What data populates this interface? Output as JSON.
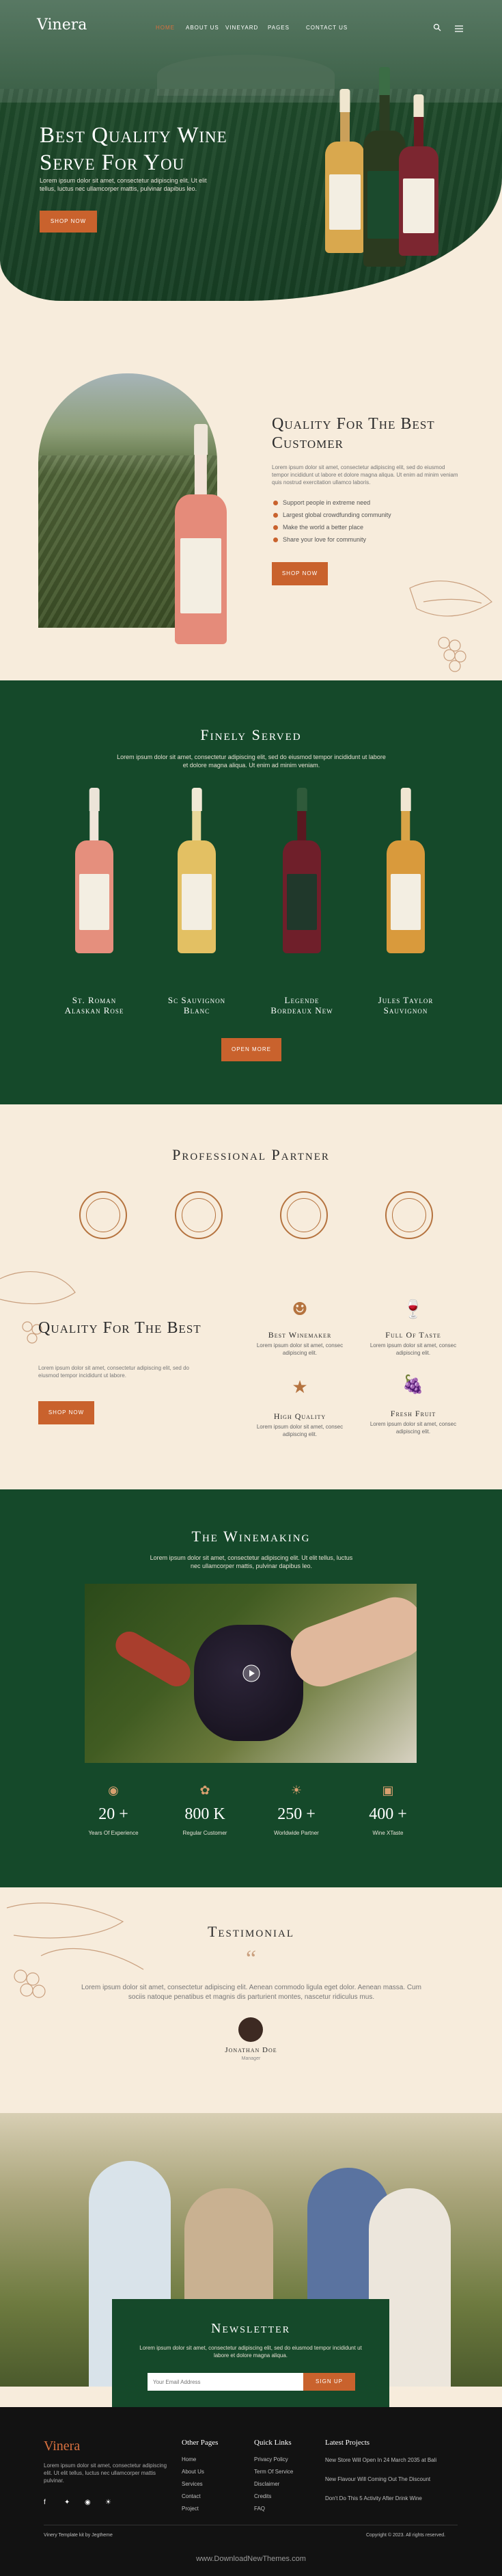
{
  "brand": "Vinera",
  "nav": {
    "items": [
      "HOME",
      "ABOUT US",
      "VINEYARD",
      "PAGES",
      "CONTACT US"
    ],
    "active": "HOME",
    "search_icon": "search-icon",
    "menu_icon": "menu-icon"
  },
  "hero": {
    "title": "Best Quality Wine Serve For You",
    "text": "Lorem ipsum dolor sit amet, consectetur adipiscing elit. Ut elit tellus, luctus nec ullamcorper mattis, pulvinar dapibus leo.",
    "button": "SHOP NOW"
  },
  "quality": {
    "title": "Quality For The Best Customer",
    "text": "Lorem ipsum dolor sit amet, consectetur adipiscing elit, sed do eiusmod tempor incididunt ut labore et dolore magna aliqua. Ut enim ad minim veniam quis nostrud exercitation ullamco laboris.",
    "list": [
      "Support people in extreme need",
      "Largest global crowdfunding community",
      "Make the world a better place",
      "Share your love for community"
    ],
    "button": "SHOP NOW"
  },
  "finely": {
    "title": "Finely Served",
    "text": "Lorem ipsum dolor sit amet, consectetur adipiscing elit, sed do eiusmod tempor incididunt ut labore et dolore magna aliqua. Ut enim ad minim veniam.",
    "wines": [
      {
        "name1": "St. Roman",
        "name2": "Alaskan Rose"
      },
      {
        "name1": "Sc Sauvignon",
        "name2": "Blanc"
      },
      {
        "name1": "Legende",
        "name2": "Bordeaux New"
      },
      {
        "name1": "Jules Taylor",
        "name2": "Sauvignon"
      }
    ],
    "button": "OPEN MORE"
  },
  "partner": {
    "title": "Professional Partner",
    "badges": [
      "",
      "",
      "",
      ""
    ]
  },
  "quality2": {
    "title": "Quality For The Best",
    "text": "Lorem ipsum dolor sit amet, consectetur adipiscing elit, sed do eiusmod tempor incididunt ut labore.",
    "button": "SHOP NOW",
    "features": [
      {
        "title": "Best Winemaker",
        "text": "Lorem ipsum dolor sit amet, consec adipiscing elit."
      },
      {
        "title": "Full Of Taste",
        "text": "Lorem ipsum dolor sit amet, consec adipiscing elit."
      },
      {
        "title": "High Quality",
        "text": "Lorem ipsum dolor sit amet, consec adipiscing elit."
      },
      {
        "title": "Fresh Fruit",
        "text": "Lorem ipsum dolor sit amet, consec adipiscing elit."
      }
    ]
  },
  "winemaking": {
    "title": "The Winemaking",
    "text": "Lorem ipsum dolor sit amet, consectetur adipiscing elit. Ut elit tellus, luctus nec ullamcorper mattis, pulvinar dapibus leo.",
    "stats": [
      {
        "num": "20 +",
        "label": "Years Of Experience"
      },
      {
        "num": "800 K",
        "label": "Regular Customer"
      },
      {
        "num": "250 +",
        "label": "Worldwide Partner"
      },
      {
        "num": "400 +",
        "label": "Wine XTaste"
      }
    ]
  },
  "testimonial": {
    "title": "Testimonial",
    "quote": "Lorem ipsum dolor sit amet, consectetur adipiscing elit. Aenean commodo ligula eget dolor. Aenean massa. Cum sociis natoque penatibus et magnis dis parturient montes, nascetur ridiculus mus.",
    "name": "Jonathan Doe",
    "role": "Manager"
  },
  "newsletter": {
    "title": "Newsletter",
    "text": "Lorem ipsum dolor sit amet, consectetur adipiscing elit, sed do eiusmod tempor incididunt ut labore et dolore magna aliqua.",
    "placeholder": "Your Email Address",
    "button": "SIGN UP"
  },
  "footer": {
    "brand": "Vinera",
    "text": "Lorem ipsum dolor sit amet, consectetur adipiscing elit. Ut elit tellus, luctus nec ullamcorper mattis pulvinar.",
    "other_pages_title": "Other Pages",
    "other_pages": [
      "Home",
      "About Us",
      "Services",
      "Contact",
      "Project"
    ],
    "quick_links_title": "Quick Links",
    "quick_links": [
      "Privacy Policy",
      "Term Of Service",
      "Disclaimer",
      "Credits",
      "FAQ"
    ],
    "latest_title": "Latest Projects",
    "latest": [
      "New Store Will Open In 24 March 2035 at Bali",
      "New Flavour Will Coming Out The Discount",
      "Don't Do This 5 Activity After Drink Wine"
    ],
    "bottom_left": "Vinery Template kit by Jegtheme",
    "bottom_right": "Copyright © 2023. All rights reserved.",
    "social": [
      "facebook-icon",
      "twitter-icon",
      "instagram-icon",
      "pinterest-icon"
    ]
  },
  "watermark": "www.DownloadNewThemes.com"
}
